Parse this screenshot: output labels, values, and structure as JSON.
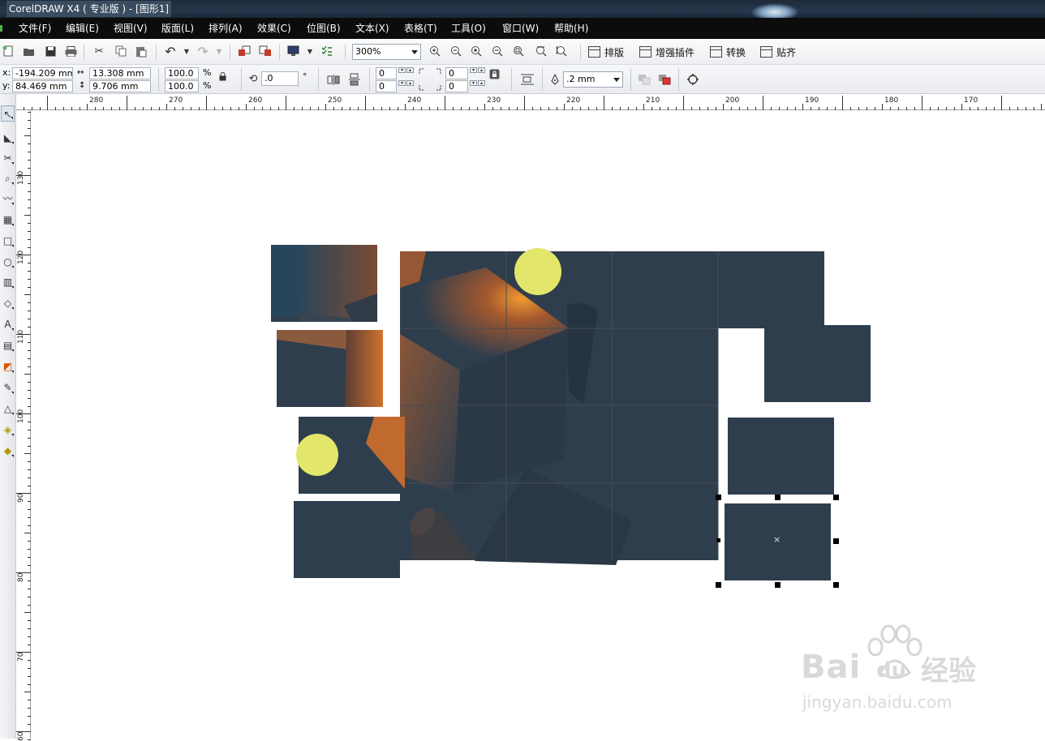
{
  "window": {
    "title": "CorelDRAW X4 ( 专业版 ) - [图形1]"
  },
  "menu": [
    {
      "label": "文件(F)"
    },
    {
      "label": "编辑(E)"
    },
    {
      "label": "视图(V)"
    },
    {
      "label": "版面(L)"
    },
    {
      "label": "排列(A)"
    },
    {
      "label": "效果(C)"
    },
    {
      "label": "位图(B)"
    },
    {
      "label": "文本(X)"
    },
    {
      "label": "表格(T)"
    },
    {
      "label": "工具(O)"
    },
    {
      "label": "窗口(W)"
    },
    {
      "label": "帮助(H)"
    }
  ],
  "toolbar": {
    "zoom_value": "300%",
    "plugins": [
      {
        "label": "排版"
      },
      {
        "label": "增强插件"
      },
      {
        "label": "转换"
      },
      {
        "label": "贴齐"
      }
    ]
  },
  "property_bar": {
    "x_label": "x:",
    "x_value": "-194.209 mm",
    "y_label": "y:",
    "y_value": "84.469 mm",
    "width_value": "13.308 mm",
    "height_value": "9.706 mm",
    "scale_w": "100.0",
    "scale_h": "100.0",
    "percent": "%",
    "rotation_value": ".0",
    "degree": "°",
    "corner_1": "0",
    "corner_2": "0",
    "corner_3": "0",
    "corner_4": "0",
    "outline_width": ".2 mm"
  },
  "rulers": {
    "horizontal": [
      "280",
      "270",
      "260",
      "250",
      "240",
      "230",
      "220",
      "210",
      "200",
      "190",
      "180",
      "170"
    ],
    "vertical": [
      "130",
      "120",
      "110",
      "100",
      "90",
      "80",
      "70",
      "60"
    ]
  },
  "watermark": {
    "brand": "Bai",
    "du": "du",
    "cn": "经验",
    "url": "jingyan.baidu.com"
  },
  "colors": {
    "piece": "#2f3e4d",
    "moon": "#e2e66a",
    "cube_glow": "#e8882e"
  }
}
